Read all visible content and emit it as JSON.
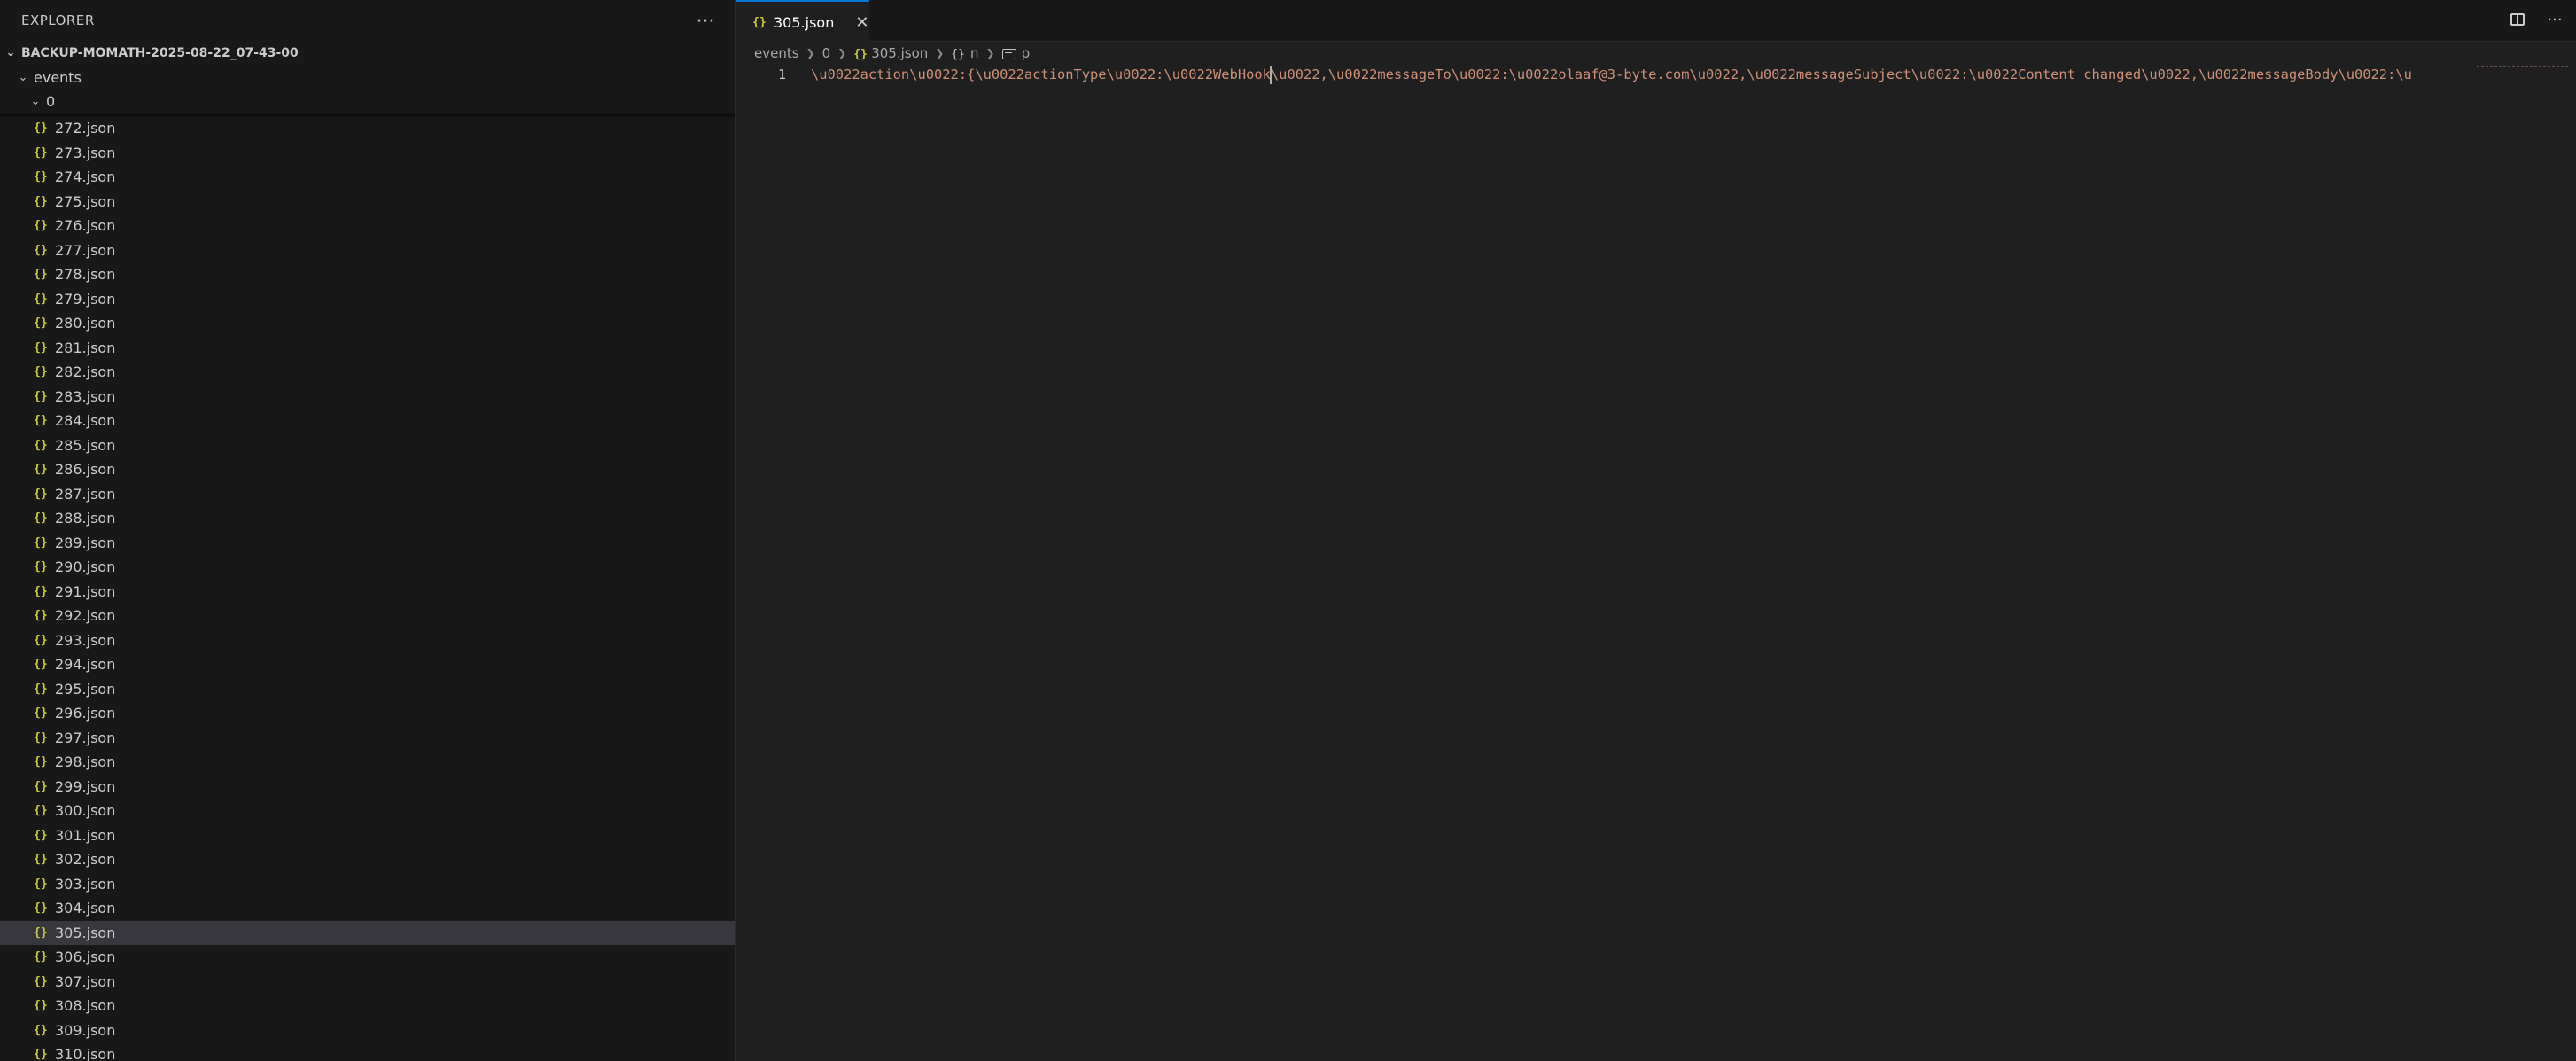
{
  "explorer": {
    "title": "EXPLORER",
    "more_label": "···",
    "root_folder": "BACKUP-MOMATH-2025-08-22_07-43-00",
    "folder_events": "events",
    "folder_0": "0",
    "files": [
      "272.json",
      "273.json",
      "274.json",
      "275.json",
      "276.json",
      "277.json",
      "278.json",
      "279.json",
      "280.json",
      "281.json",
      "282.json",
      "283.json",
      "284.json",
      "285.json",
      "286.json",
      "287.json",
      "288.json",
      "289.json",
      "290.json",
      "291.json",
      "292.json",
      "293.json",
      "294.json",
      "295.json",
      "296.json",
      "297.json",
      "298.json",
      "299.json",
      "300.json",
      "301.json",
      "302.json",
      "303.json",
      "304.json",
      "305.json",
      "306.json",
      "307.json",
      "308.json",
      "309.json",
      "310.json"
    ],
    "selected_file": "305.json",
    "file_icon": "json-braces-icon"
  },
  "editor": {
    "tab_label": "305.json",
    "tab_close": "✕",
    "more_label": "···",
    "breadcrumb": {
      "events": "events",
      "folder": "0",
      "file": "305.json",
      "object": "n",
      "string": "p"
    },
    "line_number": "1",
    "code_before_cursor": "\\u0022action\\u0022:{\\u0022actionType\\u0022:\\u0022WebHook",
    "code_after_cursor": "\\u0022,\\u0022messageTo\\u0022:\\u0022olaaf@3-byte.com\\u0022,\\u0022messageSubject\\u0022:\\u0022Content changed\\u0022,\\u0022messageBody\\u0022:\\u"
  },
  "colors": {
    "accent": "#0078d4",
    "string": "#ce9178",
    "json_icon": "#cbcb41",
    "selection": "#37373d"
  }
}
